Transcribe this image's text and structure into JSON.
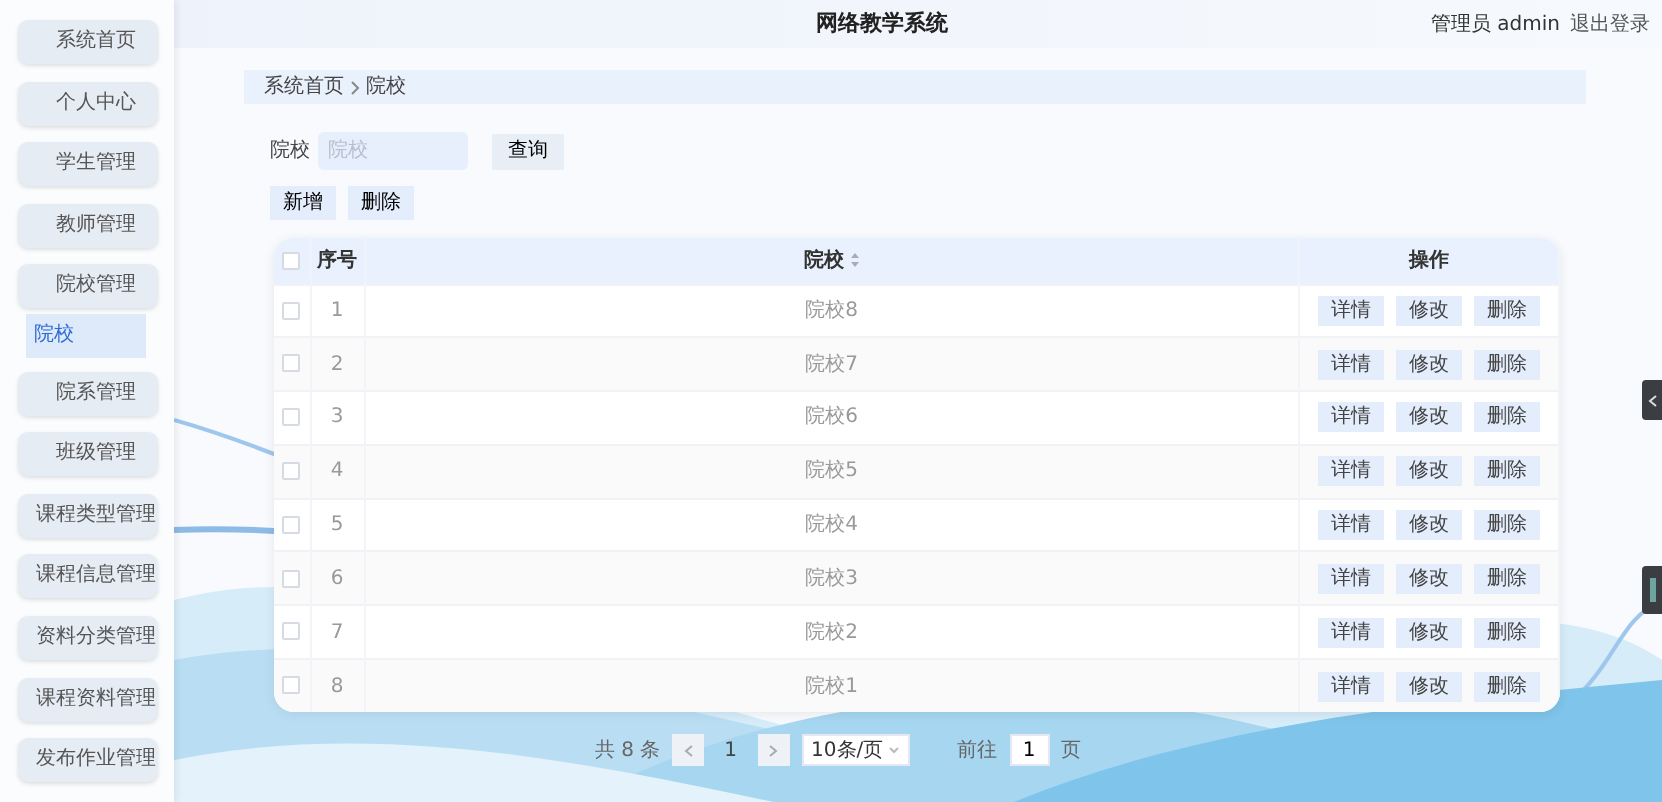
{
  "header": {
    "title": "网络教学系统",
    "user": "管理员 admin",
    "logout": "退出登录"
  },
  "sidebar": {
    "items": [
      {
        "label": "系统首页"
      },
      {
        "label": "个人中心"
      },
      {
        "label": "学生管理"
      },
      {
        "label": "教师管理"
      },
      {
        "label": "院校管理",
        "children": [
          {
            "label": "院校",
            "selected": true
          }
        ]
      },
      {
        "label": "院系管理"
      },
      {
        "label": "班级管理"
      },
      {
        "label": "课程类型管理"
      },
      {
        "label": "课程信息管理"
      },
      {
        "label": "资料分类管理"
      },
      {
        "label": "课程资料管理"
      },
      {
        "label": "发布作业管理"
      }
    ]
  },
  "breadcrumb": [
    "系统首页",
    "院校"
  ],
  "search": {
    "label": "院校",
    "placeholder": "院校",
    "button": "查询"
  },
  "actions": [
    "新增",
    "删除"
  ],
  "table": {
    "columns": [
      "序号",
      "院校",
      "操作"
    ],
    "all_selected": false,
    "rows": [
      {
        "index": "1",
        "name": "院校8",
        "selected": false,
        "actions": [
          "详情",
          "修改",
          "删除"
        ]
      },
      {
        "index": "2",
        "name": "院校7",
        "selected": false,
        "actions": [
          "详情",
          "修改",
          "删除"
        ]
      },
      {
        "index": "3",
        "name": "院校6",
        "selected": false,
        "actions": [
          "详情",
          "修改",
          "删除"
        ]
      },
      {
        "index": "4",
        "name": "院校5",
        "selected": false,
        "actions": [
          "详情",
          "修改",
          "删除"
        ]
      },
      {
        "index": "5",
        "name": "院校4",
        "selected": false,
        "actions": [
          "详情",
          "修改",
          "删除"
        ]
      },
      {
        "index": "6",
        "name": "院校3",
        "selected": false,
        "actions": [
          "详情",
          "修改",
          "删除"
        ]
      },
      {
        "index": "7",
        "name": "院校2",
        "selected": false,
        "actions": [
          "详情",
          "修改",
          "删除"
        ]
      },
      {
        "index": "8",
        "name": "院校1",
        "selected": false,
        "actions": [
          "详情",
          "修改",
          "删除"
        ]
      }
    ]
  },
  "pagination": {
    "total": "共 8 条",
    "page": "1",
    "page_size": "10条/页",
    "goto_label": "前往",
    "goto_value": "1",
    "goto_suffix": "页"
  }
}
